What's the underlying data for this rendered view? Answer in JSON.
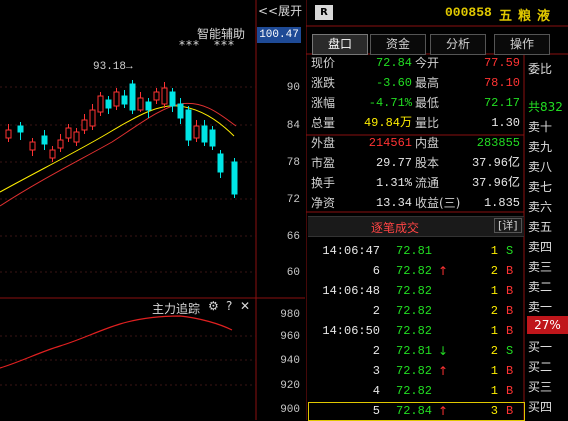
{
  "toolbar": {
    "expand_label": "<<展开",
    "smart_assist_label": "智能辅助",
    "stars_a": "***",
    "stars_b": "***"
  },
  "chart": {
    "current_price_tag": "100.47",
    "high_marker": "93.18→",
    "price_axis": [
      "90",
      "84",
      "78",
      "72",
      "66",
      "60"
    ],
    "indicator_axis": [
      "980",
      "960",
      "940",
      "920",
      "900"
    ],
    "tracking_title": "主力追踪",
    "colors": {
      "up": "#ff3333",
      "down": "#00e5e5",
      "ma_fast": "#ffee00",
      "ma_slow": "#e03030"
    }
  },
  "stock": {
    "badge": "R",
    "code": "000858",
    "name": "五粮液"
  },
  "tabs": [
    {
      "label": "盘口",
      "active": true
    },
    {
      "label": "资金",
      "active": false
    },
    {
      "label": "分析",
      "active": false
    },
    {
      "label": "操作",
      "active": false
    }
  ],
  "quote": {
    "rows": [
      {
        "l1": "现价",
        "v1": "72.84",
        "c1": "down",
        "l2": "今开",
        "v2": "77.59",
        "c2": "up"
      },
      {
        "l1": "涨跌",
        "v1": "-3.60",
        "c1": "down",
        "l2": "最高",
        "v2": "78.10",
        "c2": "up"
      },
      {
        "l1": "涨幅",
        "v1": "-4.71%",
        "c1": "down",
        "l2": "最低",
        "v2": "72.17",
        "c2": "down"
      },
      {
        "l1": "总量",
        "v1": "49.84万",
        "c1": "yel",
        "l2": "量比",
        "v2": "1.30",
        "c2": "wht"
      },
      {
        "l1": "外盘",
        "v1": "214561",
        "c1": "up",
        "l2": "内盘",
        "v2": "283855",
        "c2": "down"
      },
      {
        "l1": "市盈",
        "v1": "29.77",
        "c1": "wht",
        "l2": "股本",
        "v2": "37.96亿",
        "c2": "wht"
      },
      {
        "l1": "换手",
        "v1": "1.31%",
        "c1": "wht",
        "l2": "流通",
        "v2": "37.96亿",
        "c2": "wht"
      },
      {
        "l1": "净资",
        "v1": "13.34",
        "c1": "wht",
        "l2": "收益(三)",
        "v2": "1.835",
        "c2": "wht"
      }
    ]
  },
  "ticks": {
    "title": "逐笔成交",
    "detail_label": "[详]",
    "rows": [
      {
        "time": "14:06:47",
        "price": "72.81",
        "arrow": "",
        "vol": "1",
        "side": "S"
      },
      {
        "time": "6",
        "price": "72.82",
        "arrow": "↑",
        "vol": "2",
        "side": "B"
      },
      {
        "time": "14:06:48",
        "price": "72.82",
        "arrow": "",
        "vol": "1",
        "side": "B"
      },
      {
        "time": "2",
        "price": "72.82",
        "arrow": "",
        "vol": "2",
        "side": "B"
      },
      {
        "time": "14:06:50",
        "price": "72.82",
        "arrow": "",
        "vol": "1",
        "side": "B"
      },
      {
        "time": "2",
        "price": "72.81",
        "arrow": "↓",
        "vol": "2",
        "side": "S"
      },
      {
        "time": "3",
        "price": "72.82",
        "arrow": "↑",
        "vol": "1",
        "side": "B"
      },
      {
        "time": "4",
        "price": "72.82",
        "arrow": "",
        "vol": "1",
        "side": "B"
      },
      {
        "time": "5",
        "price": "72.84",
        "arrow": "↑",
        "vol": "3",
        "side": "B"
      }
    ]
  },
  "orderbook": {
    "wei_bi": "委比",
    "total_prefix": "共832",
    "sell_levels": [
      "卖十",
      "卖九",
      "卖八",
      "卖七",
      "卖六",
      "卖五",
      "卖四",
      "卖三",
      "卖二",
      "卖一"
    ],
    "pct": "27%",
    "buy_levels": [
      "买一",
      "买二",
      "买三",
      "买四"
    ]
  }
}
